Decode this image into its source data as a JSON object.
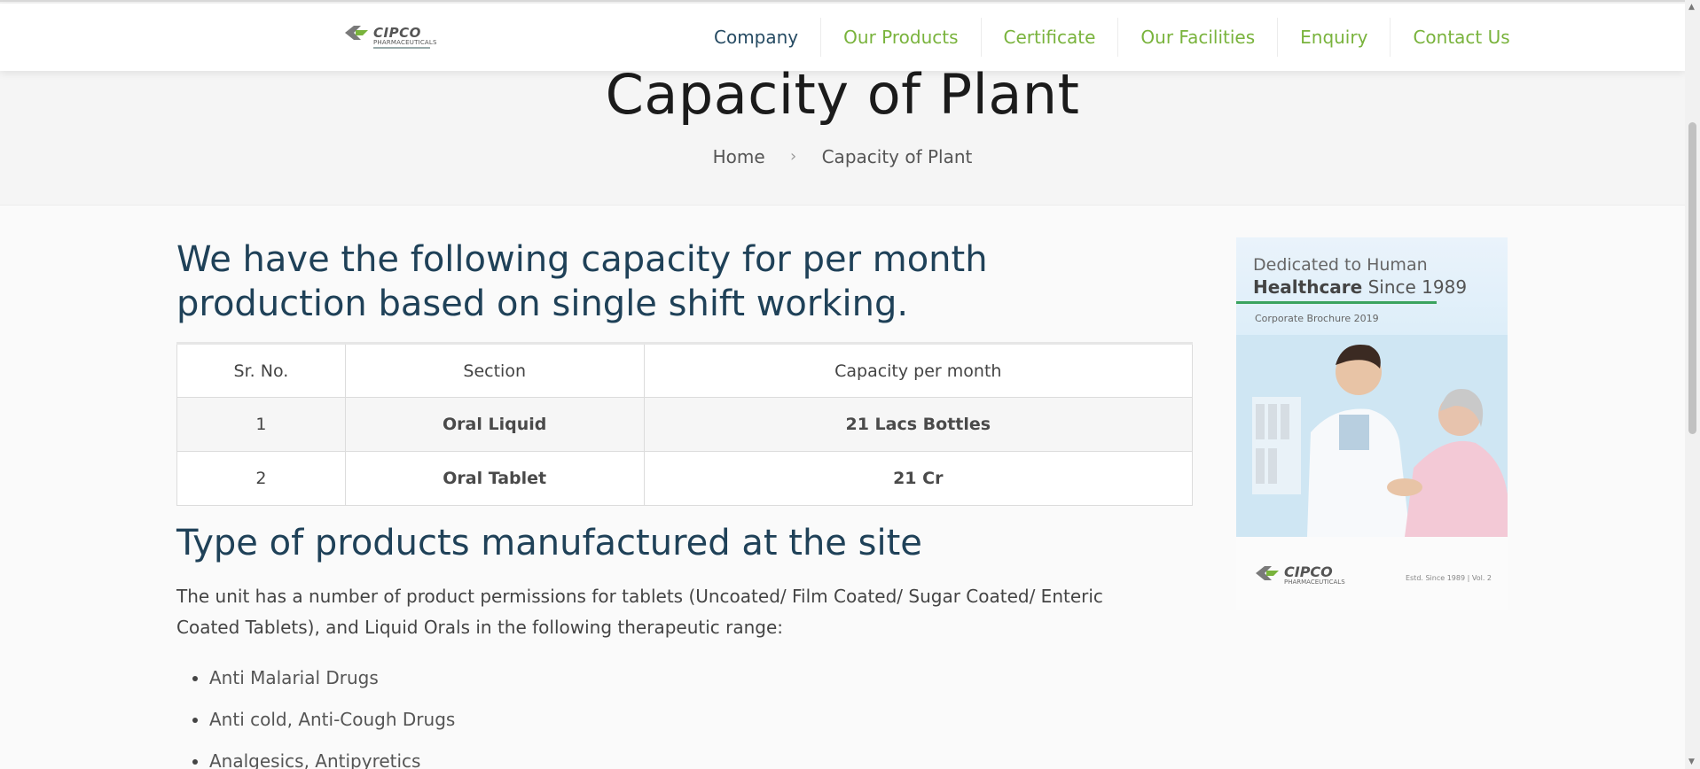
{
  "header": {
    "logo_brand": "CIPCO",
    "logo_sub": "PHARMACEUTICALS",
    "nav": [
      "Company",
      "Our Products",
      "Certificate",
      "Our Facilities",
      "Enquiry",
      "Contact Us"
    ]
  },
  "hero": {
    "title": "Capacity of Plant",
    "breadcrumb_home": "Home",
    "breadcrumb_sep": "›",
    "breadcrumb_current": "Capacity of Plant"
  },
  "main": {
    "intro": "We have the following capacity for per month production based on single shift working.",
    "table": {
      "headers": [
        "Sr. No.",
        "Section",
        "Capacity per month"
      ],
      "rows": [
        [
          "1",
          "Oral Liquid",
          "21 Lacs Bottles"
        ],
        [
          "2",
          "Oral Tablet",
          "21 Cr"
        ]
      ]
    },
    "products_heading": "Type of products manufactured at the site",
    "products_text": "The unit has a number of product permissions for tablets (Uncoated/ Film Coated/ Sugar Coated/ Enteric Coated Tablets), and Liquid Orals in the following therapeutic range:",
    "ranges": [
      "Anti Malarial Drugs",
      "Anti cold, Anti-Cough Drugs",
      "Analgesics, Antipyretics"
    ]
  },
  "brochure": {
    "line1": "Dedicated to Human",
    "line2_bold": "Healthcare",
    "line2_rest": " Since 1989",
    "small": "Corporate Brochure 2019",
    "logo_brand": "CIPCO",
    "logo_sub": "PHARMACEUTICALS",
    "estd": "Estd. Since 1989  |  Vol. 2"
  },
  "colors": {
    "nav_active": "#264b63",
    "nav_link": "#79b33c",
    "heading": "#1f4158"
  }
}
